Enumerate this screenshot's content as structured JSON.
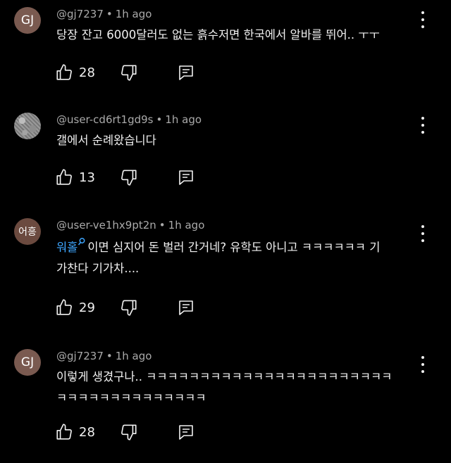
{
  "comments": [
    {
      "avatar_text": "GJ",
      "author": "@gj7237",
      "time": "1h ago",
      "text": "당장 잔고 6000달러도 없는 흙수저면 한국에서 알바를 뛰어.. ㅜㅜ",
      "likes": "28"
    },
    {
      "avatar_text": "",
      "author": "@user-cd6rt1gd9s",
      "time": "1h ago",
      "text": "갤에서 순례왔습니다",
      "likes": "13"
    },
    {
      "avatar_text": "어흥",
      "author": "@user-ve1hx9pt2n",
      "time": "1h ago",
      "mention": "워홀",
      "text_line1": "이면 심지어 돈 벌러 간거네? 유학도 아니고 ㅋㅋㅋㅋㅋㅋ 기",
      "text_line2": "가찬다 기가차....",
      "likes": "29"
    },
    {
      "avatar_text": "GJ",
      "author": "@gj7237",
      "time": "1h ago",
      "text_line1": "이렇게 생겼구나.. ㅋㅋㅋㅋㅋㅋㅋㅋㅋㅋㅋㅋㅋㅋㅋㅋㅋㅋㅋㅋㅋㅋㅋ",
      "text_line2": "ㅋㅋㅋㅋㅋㅋㅋㅋㅋㅋㅋㅋㅋㅋ",
      "likes": "28"
    }
  ],
  "meta_separator": "•",
  "icons": {
    "like": "thumbs-up-icon",
    "dislike": "thumbs-down-icon",
    "reply": "reply-icon",
    "more": "more-vert-icon",
    "mention": "search-icon"
  },
  "colors": {
    "background": "#000000",
    "text": "#f1f1f1",
    "secondary": "#aaaaaa",
    "mention": "#3ea6ff"
  }
}
